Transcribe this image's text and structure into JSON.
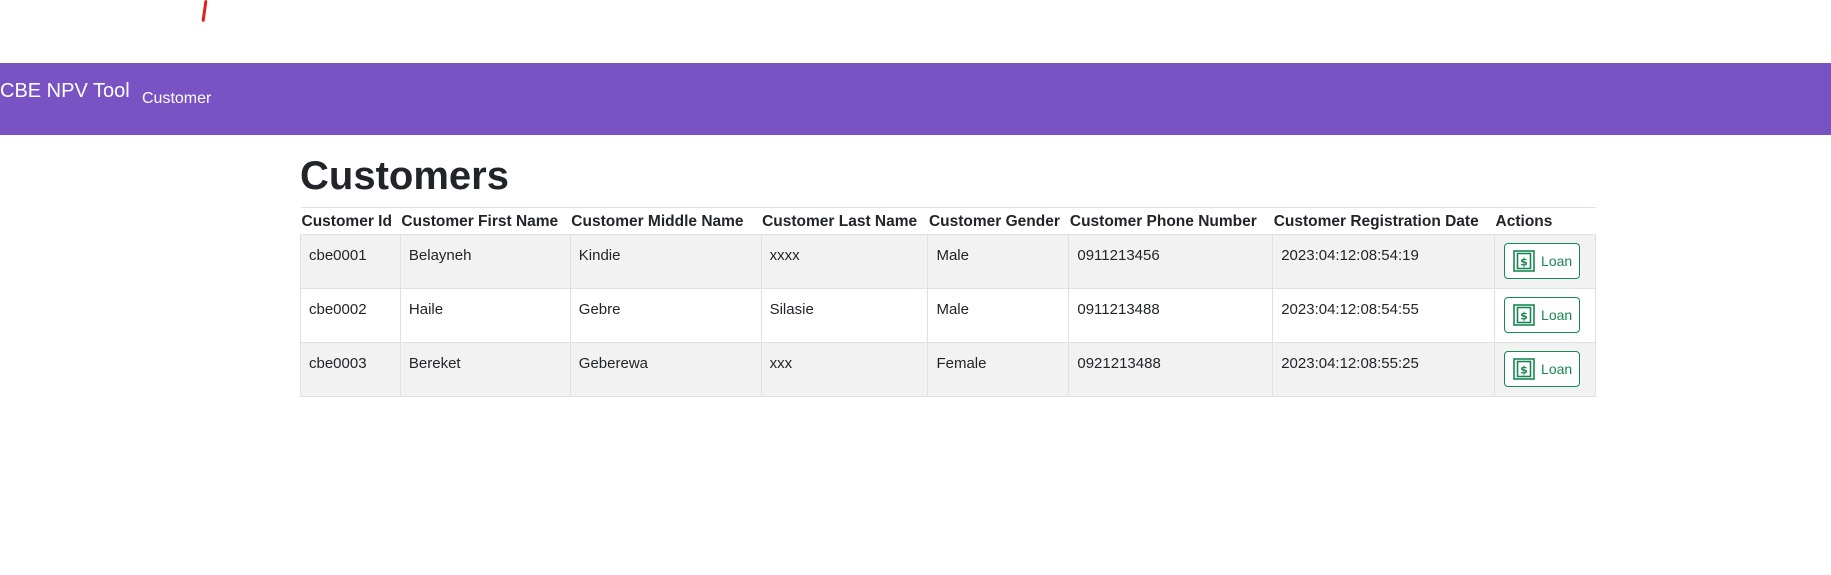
{
  "navbar": {
    "brand": "CBE NPV Tool",
    "links": [
      {
        "label": "Customer"
      }
    ],
    "background": "#7952c3"
  },
  "page": {
    "title": "Customers"
  },
  "table": {
    "headers": [
      "Customer Id",
      "Customer First Name",
      "Customer Middle Name",
      "Customer Last Name",
      "Customer Gender",
      "Customer Phone Number",
      "Customer Registration Date",
      "Actions"
    ],
    "rows": [
      {
        "id": "cbe0001",
        "first_name": "Belayneh",
        "middle_name": "Kindie",
        "last_name": "xxxx",
        "gender": "Male",
        "phone": "0911213456",
        "registration_date": "2023:04:12:08:54:19",
        "action_label": "Loan"
      },
      {
        "id": "cbe0002",
        "first_name": "Haile",
        "middle_name": "Gebre",
        "last_name": "Silasie",
        "gender": "Male",
        "phone": "0911213488",
        "registration_date": "2023:04:12:08:54:55",
        "action_label": "Loan"
      },
      {
        "id": "cbe0003",
        "first_name": "Bereket",
        "middle_name": "Geberewa",
        "last_name": "xxx",
        "gender": "Female",
        "phone": "0921213488",
        "registration_date": "2023:04:12:08:55:25",
        "action_label": "Loan"
      }
    ]
  },
  "icons": {
    "loan": "cash-dollar-icon"
  },
  "colors": {
    "accent": "#7952c3",
    "success": "#198754",
    "stripe": "#f2f2f2"
  }
}
